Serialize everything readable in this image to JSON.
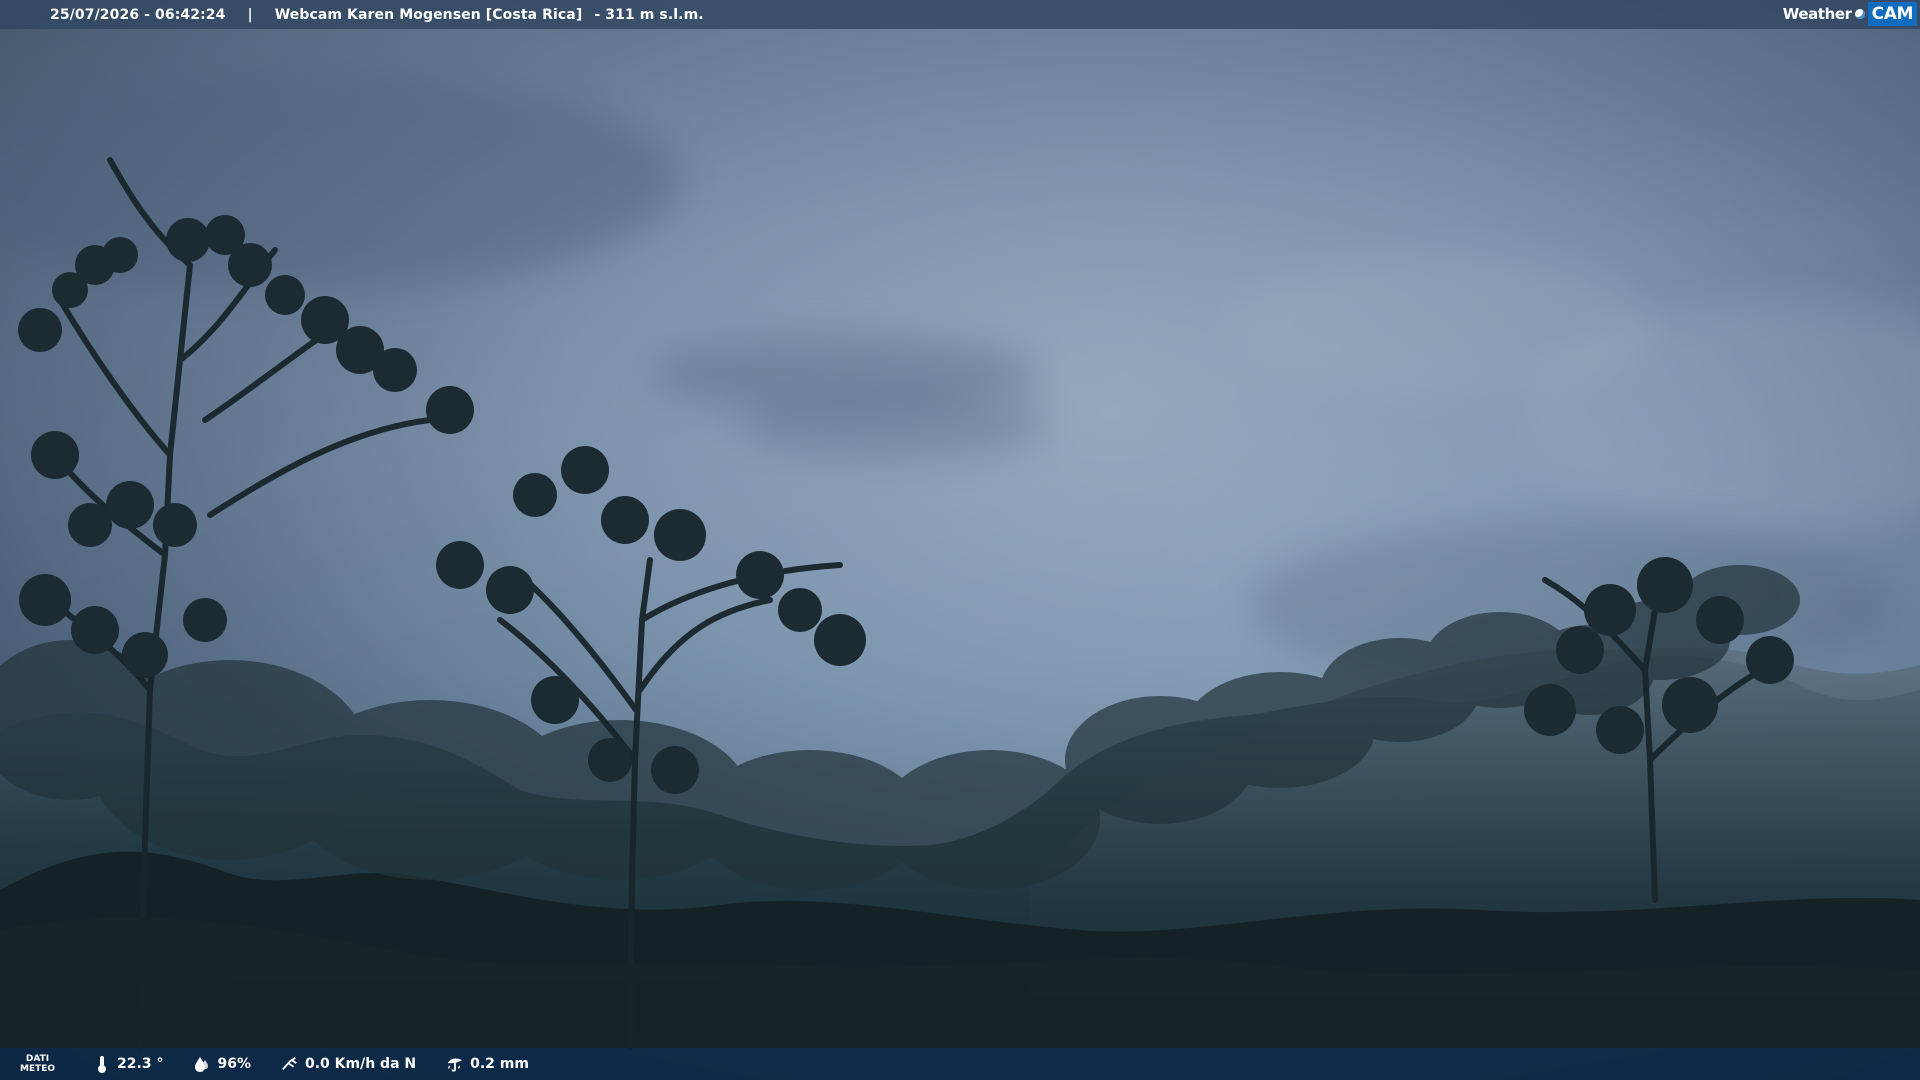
{
  "top_bar": {
    "datetime": "25/07/2026 - 06:42:24",
    "separator": "|",
    "webcam_title": "Webcam Karen Mogensen [Costa Rica]",
    "altitude": "- 311 m s.l.m.",
    "logo_text_left": "Weather",
    "logo_text_right": "CAM"
  },
  "bottom_bar": {
    "dati_line1": "DATI",
    "dati_line2": "METEO",
    "temperature": "22.3 °",
    "humidity": "96%",
    "wind": "0.0 Km/h da N",
    "rain": "0.2 mm"
  },
  "icons": {
    "temperature": "thermometer-icon",
    "humidity": "humidity-drop-icon",
    "wind": "wind-direction-icon",
    "rain": "rain-umbrella-icon"
  },
  "colors": {
    "top_bar": "#314560",
    "bottom_bar": "#0a2745",
    "logo_blue": "#0f6cbf"
  }
}
